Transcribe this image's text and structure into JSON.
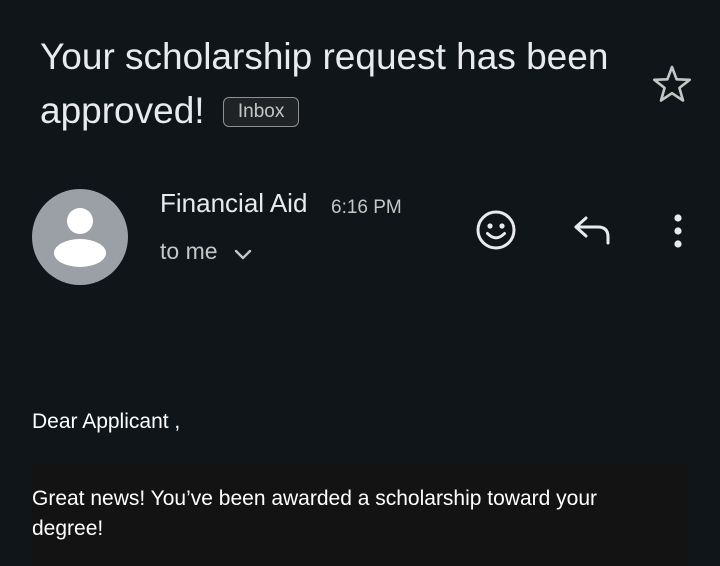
{
  "email": {
    "subject": "Your scholarship request has been approved!",
    "label": "Inbox",
    "sender": "Financial Aid",
    "time": "6:16 PM",
    "recipient": "to me",
    "greeting": "Dear Applicant ,",
    "body": "Great news! You’ve been awarded a scholarship toward your degree!"
  },
  "icons": {
    "star": "star-icon",
    "avatar": "person-icon",
    "expand": "chevron-down-icon",
    "emoji": "smiley-icon",
    "reply": "reply-icon",
    "more": "more-vert-icon"
  },
  "colors": {
    "background": "#0f1519",
    "text": "#e8eaed",
    "secondary_text": "#c4c7c5",
    "avatar": "#9aa0a6"
  }
}
